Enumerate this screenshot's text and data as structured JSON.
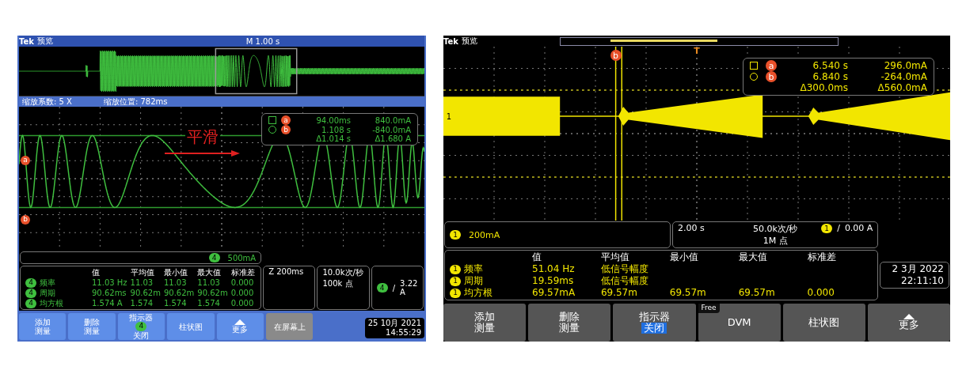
{
  "scopes": [
    {
      "kind": "zoom",
      "color": "#3fbf3f",
      "title_bar": {
        "brand": "Tek",
        "mode": "预览",
        "timebase": "M 1.00 s"
      },
      "zoom_bar": {
        "factor": "缩放系数: 5 X",
        "position": "缩放位置: 782ms"
      },
      "annotation": "平滑",
      "cursor_markers": [
        "a",
        "b"
      ],
      "readout": {
        "rows": [
          {
            "marker": "a",
            "time": "94.00ms",
            "value": "840.0mA"
          },
          {
            "marker": "b",
            "time": "1.108 s",
            "value": "-840.0mA"
          }
        ],
        "delta": {
          "time": "Δ1.014 s",
          "value": "Δ1.680 A"
        }
      },
      "channel": {
        "number": "4",
        "scale": "500mA"
      },
      "horizontal": "Z 200ms",
      "sample_rate": "10.0k次/秒",
      "record": "100k 点",
      "trigger": {
        "channel": "4",
        "slope": "/",
        "level": "3.22 A"
      },
      "measurements": {
        "columns": [
          "值",
          "平均值",
          "最小值",
          "最大值",
          "标准差"
        ],
        "rows": [
          {
            "channel": "4",
            "name": "频率",
            "cells": [
              "11.03 Hz",
              "11.03",
              "11.03",
              "11.03",
              "0.000"
            ]
          },
          {
            "channel": "4",
            "name": "周期",
            "cells": [
              "90.62ms",
              "90.62m",
              "90.62m",
              "90.62m",
              "0.000"
            ]
          },
          {
            "channel": "4",
            "name": "均方根",
            "cells": [
              "1.574 A",
              "1.574",
              "1.574",
              "1.574",
              "0.000"
            ]
          }
        ]
      },
      "buttons": [
        {
          "kind": "menu",
          "lines": [
            "添加",
            "测量"
          ],
          "disabled": false
        },
        {
          "kind": "menu",
          "lines": [
            "删除",
            "测量"
          ],
          "disabled": false
        },
        {
          "kind": "menu",
          "lines": [
            "指示器"
          ],
          "badge": "4",
          "status": "关闭",
          "status_highlighted": false,
          "disabled": false
        },
        {
          "kind": "menu",
          "lines": [
            "柱状图"
          ],
          "disabled": false
        },
        {
          "kind": "more",
          "lines": [
            "更多"
          ],
          "disabled": false
        },
        {
          "kind": "menu",
          "lines": [
            "在屏幕上"
          ],
          "disabled": true
        }
      ],
      "datetime": {
        "date": "25 10月 2021",
        "time": "14:55:29"
      }
    },
    {
      "kind": "standard",
      "color": "#f2e600",
      "title_bar": {
        "brand": "Tek",
        "mode": "预览"
      },
      "ground_marker": "1",
      "trigger_marker": "T",
      "cursor_markers": [
        "b"
      ],
      "readout": {
        "rows": [
          {
            "marker": "a",
            "time": "6.540 s",
            "value": "296.0mA"
          },
          {
            "marker": "b",
            "time": "6.840 s",
            "value": "-264.0mA"
          }
        ],
        "delta": {
          "time": "Δ300.0ms",
          "value": "Δ560.0mA"
        }
      },
      "channel": {
        "number": "1",
        "scale": "200mA"
      },
      "horizontal": "2.00 s",
      "sample_rate": "50.0k次/秒",
      "record": "1M 点",
      "trigger": {
        "channel": "1",
        "slope": "/",
        "level": "0.00 A"
      },
      "measurements": {
        "columns": [
          "值",
          "平均值",
          "最小值",
          "最大值",
          "标准差"
        ],
        "rows": [
          {
            "channel": "1",
            "name": "频率",
            "cells": [
              "51.04 Hz",
              "低信号幅度"
            ]
          },
          {
            "channel": "1",
            "name": "周期",
            "cells": [
              "19.59ms",
              "低信号幅度"
            ]
          },
          {
            "channel": "1",
            "name": "均方根",
            "cells": [
              "69.57mA",
              "69.57m",
              "69.57m",
              "69.57m",
              "0.000"
            ]
          }
        ]
      },
      "buttons": [
        {
          "kind": "menu",
          "lines": [
            "添加",
            "测量"
          ],
          "disabled": false
        },
        {
          "kind": "menu",
          "lines": [
            "删除",
            "测量"
          ],
          "disabled": false
        },
        {
          "kind": "menu",
          "lines": [
            "指示器"
          ],
          "status": "关闭",
          "status_highlighted": true,
          "disabled": false
        },
        {
          "kind": "menu",
          "lines": [
            "DVM"
          ],
          "tag": "Free",
          "disabled": false
        },
        {
          "kind": "menu",
          "lines": [
            "柱状图"
          ],
          "disabled": false
        },
        {
          "kind": "more",
          "lines": [
            "更多"
          ],
          "disabled": false
        }
      ],
      "datetime": {
        "date": "2 3月 2022",
        "time": "22:11:10"
      }
    }
  ]
}
